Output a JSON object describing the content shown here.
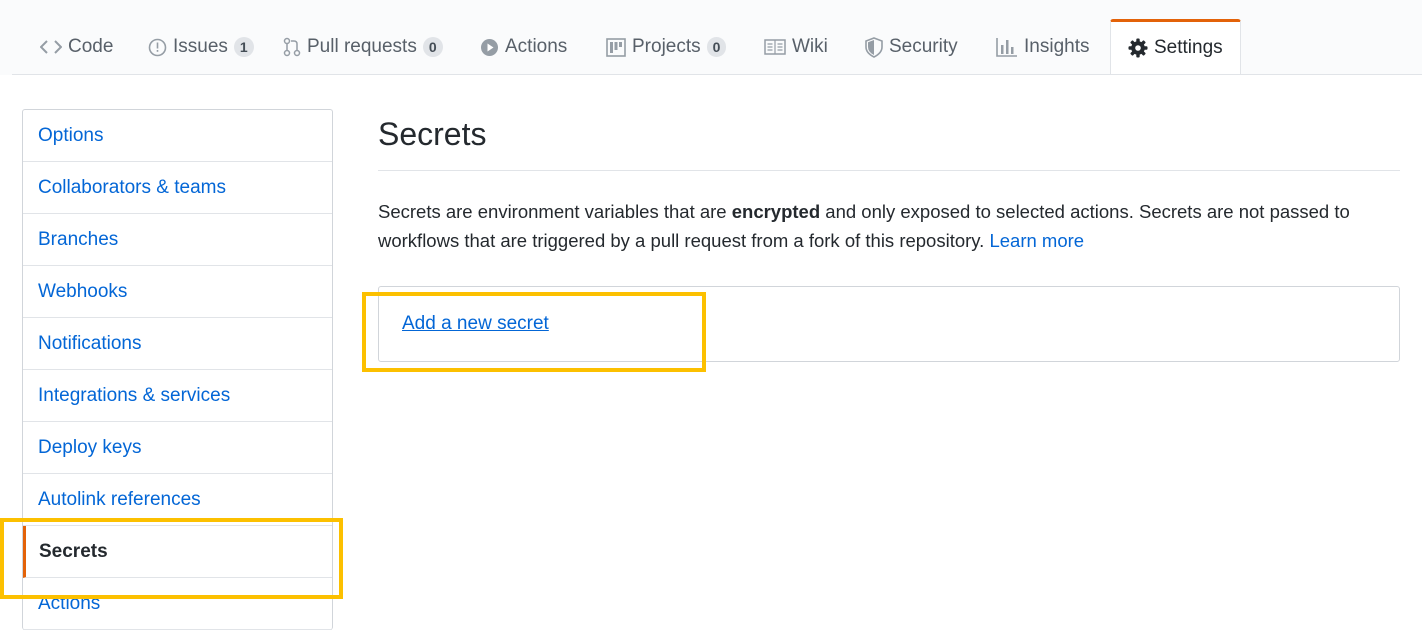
{
  "tabs": [
    {
      "label": "Code",
      "icon": "code-icon"
    },
    {
      "label": "Issues",
      "icon": "issue-icon",
      "count": "1"
    },
    {
      "label": "Pull requests",
      "icon": "pull-request-icon",
      "count": "0"
    },
    {
      "label": "Actions",
      "icon": "play-icon"
    },
    {
      "label": "Projects",
      "icon": "project-icon",
      "count": "0"
    },
    {
      "label": "Wiki",
      "icon": "book-icon"
    },
    {
      "label": "Security",
      "icon": "shield-icon"
    },
    {
      "label": "Insights",
      "icon": "graph-icon"
    },
    {
      "label": "Settings",
      "icon": "gear-icon"
    }
  ],
  "sidebar": {
    "items": [
      {
        "label": "Options"
      },
      {
        "label": "Collaborators & teams"
      },
      {
        "label": "Branches"
      },
      {
        "label": "Webhooks"
      },
      {
        "label": "Notifications"
      },
      {
        "label": "Integrations & services"
      },
      {
        "label": "Deploy keys"
      },
      {
        "label": "Autolink references"
      },
      {
        "label": "Secrets"
      },
      {
        "label": "Actions"
      }
    ]
  },
  "main": {
    "title": "Secrets",
    "desc_before": "Secrets are environment variables that are ",
    "desc_bold": "encrypted",
    "desc_after": " and only exposed to selected actions. Secrets are not passed to workflows that are triggered by a pull request from a fork of this repository. ",
    "learn_more": "Learn more",
    "add_secret": "Add a new secret"
  },
  "colors": {
    "accent": "#e36209",
    "link": "#0366d6",
    "highlight": "#fcc000"
  }
}
